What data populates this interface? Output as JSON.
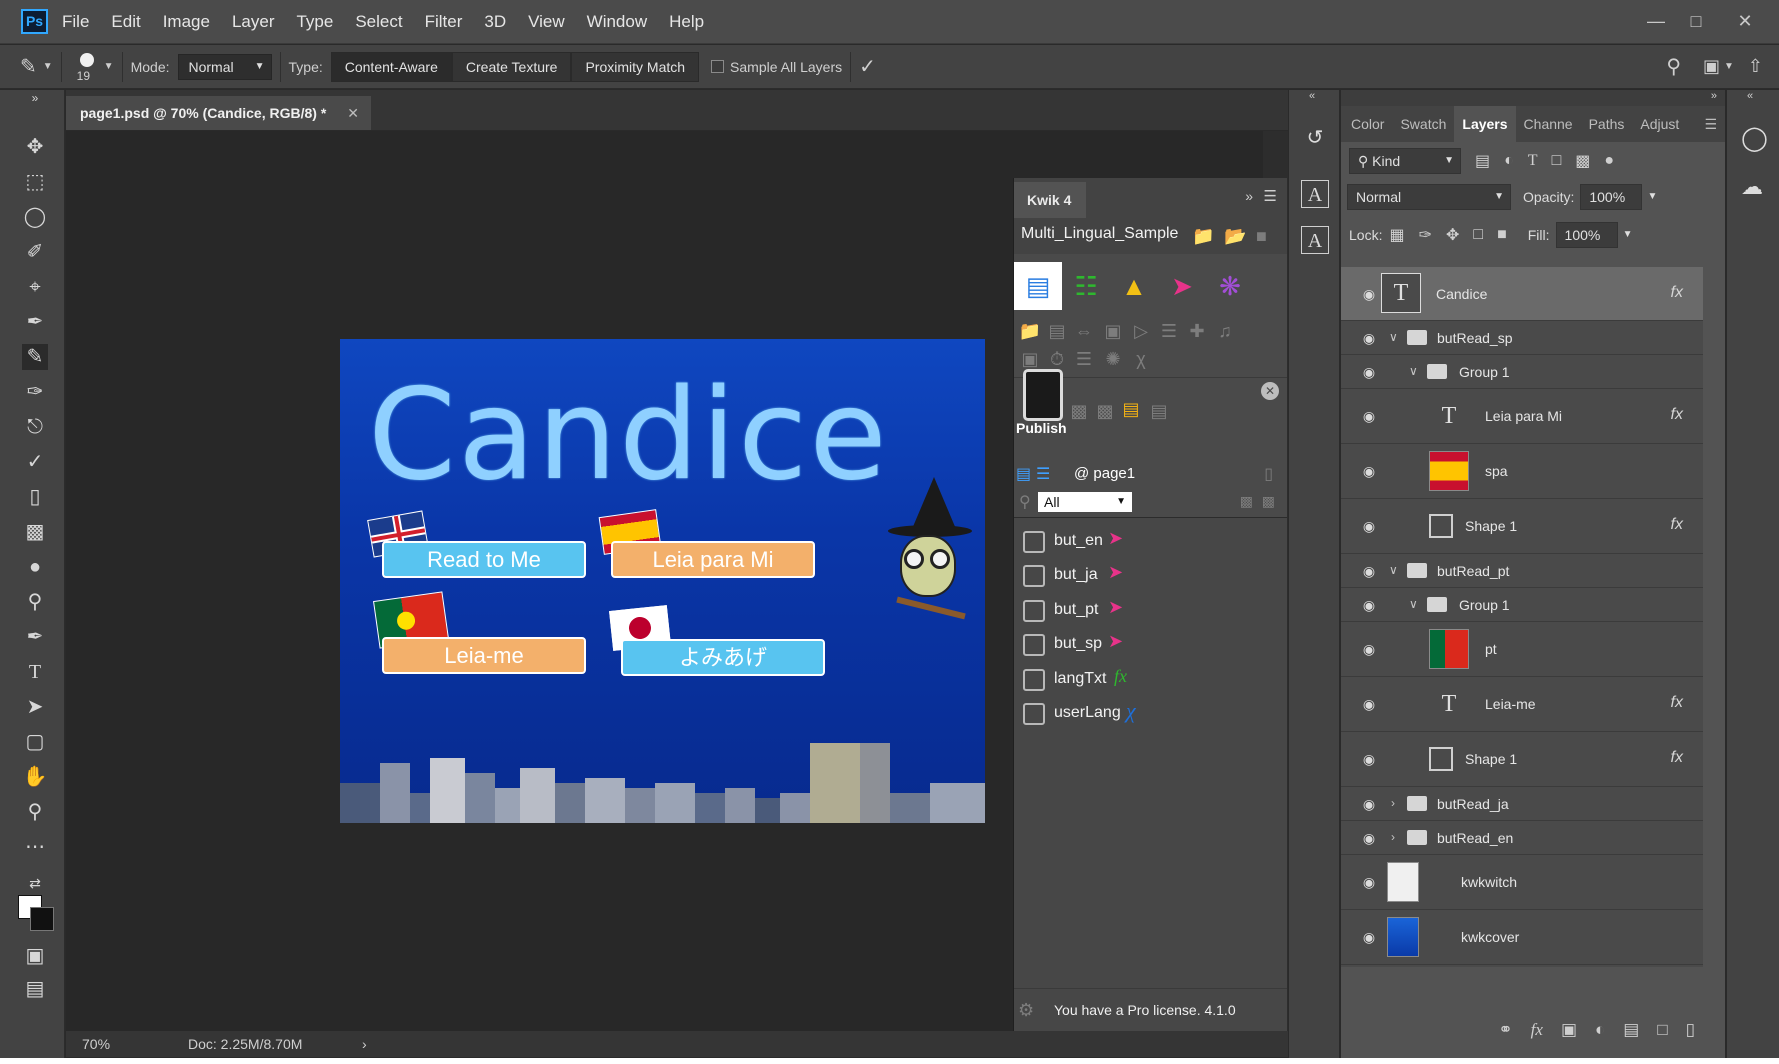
{
  "menubar": {
    "logo": "Ps",
    "items": [
      "File",
      "Edit",
      "Image",
      "Layer",
      "Type",
      "Select",
      "Filter",
      "3D",
      "View",
      "Window",
      "Help"
    ]
  },
  "options": {
    "brush_size": "19",
    "mode_label": "Mode:",
    "mode_value": "Normal",
    "type_label": "Type:",
    "type_buttons": [
      "Content-Aware",
      "Create Texture",
      "Proximity Match"
    ],
    "sample_all_layers": "Sample All Layers"
  },
  "document": {
    "tab_title": "page1.psd @ 70% (Candice, RGB/8) *",
    "canvas_title": "Candice",
    "buttons": [
      "Read to Me",
      "Leia para Mi",
      "Leia-me",
      "よみあげ"
    ],
    "zoom": "70%",
    "doc_info": "Doc: 2.25M/8.70M"
  },
  "kwik": {
    "tab": "Kwik 4",
    "project": "Multi_Lingual_Sample",
    "publish": "Publish",
    "page": "@ page1",
    "filter": "All",
    "items": [
      {
        "name": "but_en",
        "icon": "pointer-icon"
      },
      {
        "name": "but_ja",
        "icon": "pointer-icon"
      },
      {
        "name": "but_pt",
        "icon": "pointer-icon"
      },
      {
        "name": "but_sp",
        "icon": "pointer-icon"
      },
      {
        "name": "langTxt",
        "icon": "fx-icon"
      },
      {
        "name": "userLang",
        "icon": "variable-icon"
      }
    ],
    "license": "You have a Pro license. 4.1.0"
  },
  "layers_panel": {
    "tabs": [
      "Color",
      "Swatch",
      "Layers",
      "Channe",
      "Paths",
      "Adjust"
    ],
    "kind": "Kind",
    "blend_mode": "Normal",
    "opacity_label": "Opacity:",
    "opacity_value": "100%",
    "lock_label": "Lock:",
    "fill_label": "Fill:",
    "fill_value": "100%",
    "layers": [
      {
        "name": "Candice",
        "kind": "text",
        "fx": "fx"
      },
      {
        "name": "butRead_sp",
        "kind": "group"
      },
      {
        "name": "Group 1",
        "kind": "group"
      },
      {
        "name": "Leia para Mi",
        "kind": "text",
        "fx": "fx"
      },
      {
        "name": "spa",
        "kind": "image"
      },
      {
        "name": "Shape 1",
        "kind": "shape",
        "fx": "fx"
      },
      {
        "name": "butRead_pt",
        "kind": "group"
      },
      {
        "name": "Group 1",
        "kind": "group"
      },
      {
        "name": "pt",
        "kind": "image"
      },
      {
        "name": "Leia-me",
        "kind": "text",
        "fx": "fx"
      },
      {
        "name": "Shape 1",
        "kind": "shape",
        "fx": "fx"
      },
      {
        "name": "butRead_ja",
        "kind": "group"
      },
      {
        "name": "butRead_en",
        "kind": "group"
      },
      {
        "name": "kwkwitch",
        "kind": "image"
      },
      {
        "name": "kwkcover",
        "kind": "image"
      }
    ]
  },
  "colors": {
    "ps_accent": "#31a8ff",
    "kwik_pink": "#e8338a",
    "kwik_green": "#2eb82e",
    "kwik_blue": "#1e6fd9"
  }
}
